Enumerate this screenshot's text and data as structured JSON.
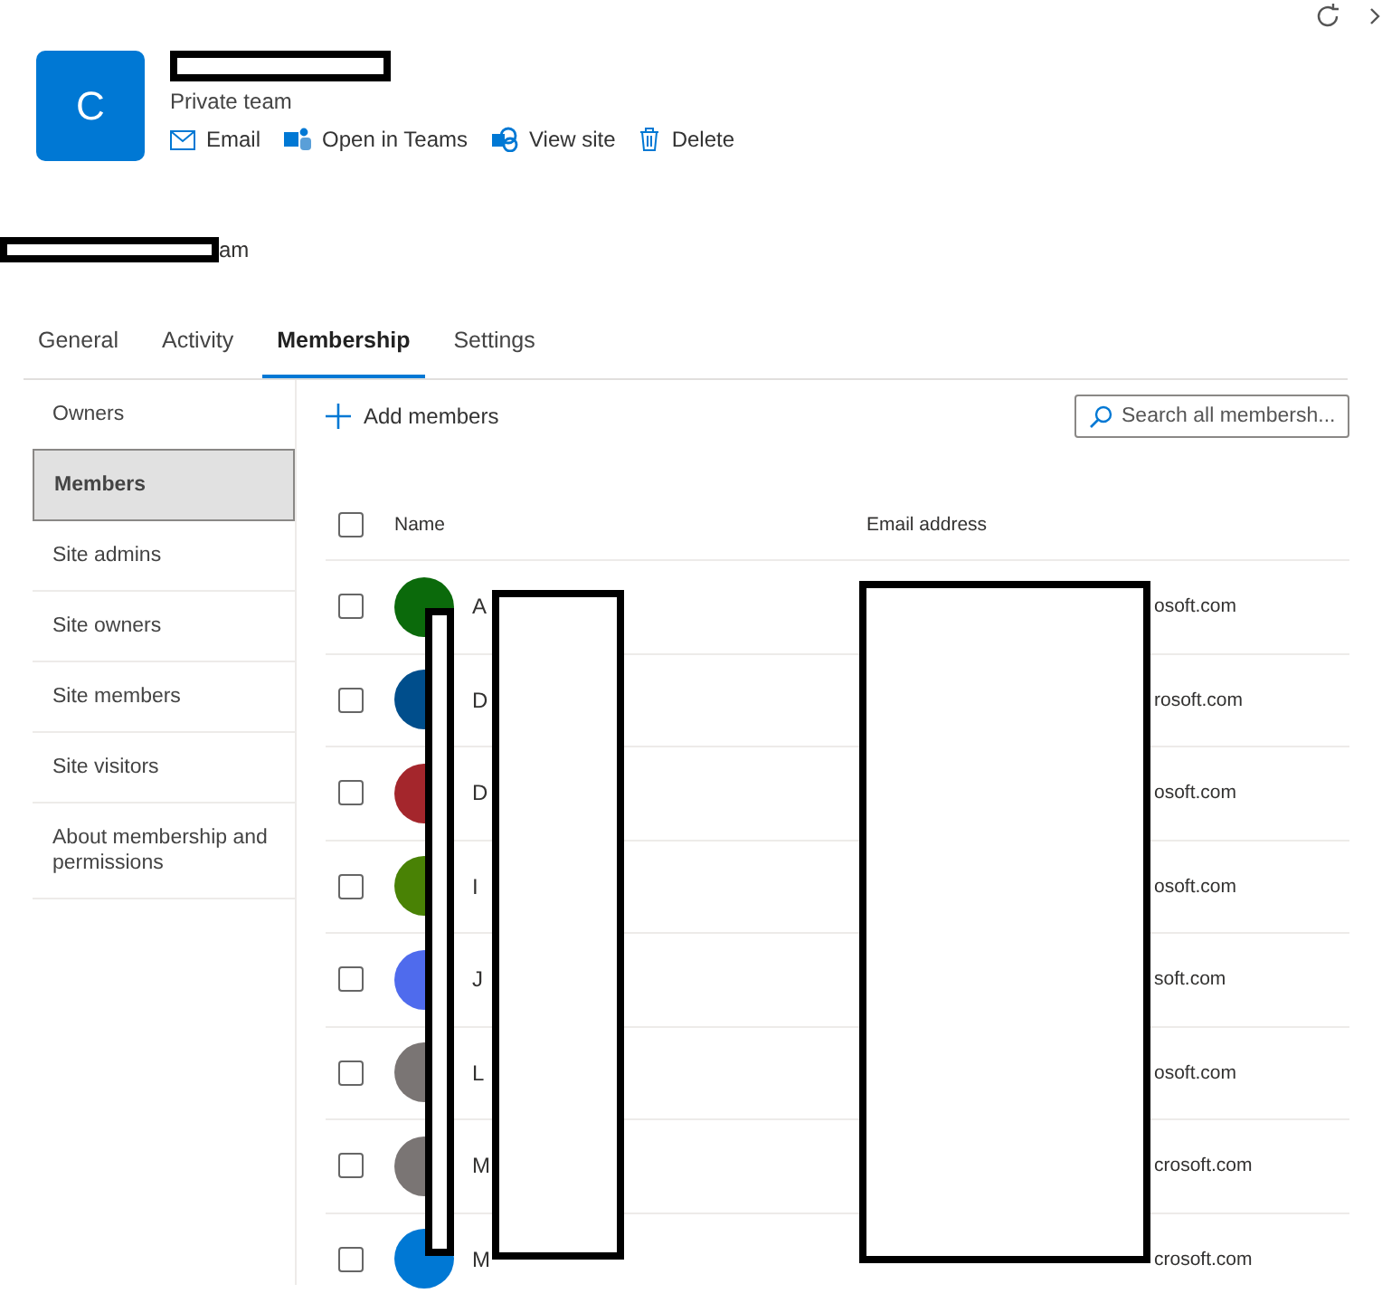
{
  "team": {
    "initial": "C",
    "privacy": "Private team"
  },
  "actions": [
    {
      "kind": "email",
      "label": "Email"
    },
    {
      "kind": "teams",
      "label": "Open in Teams"
    },
    {
      "kind": "site",
      "label": "View site"
    },
    {
      "kind": "delete",
      "label": "Delete"
    }
  ],
  "subtitle_fragment": "am",
  "tabs": [
    {
      "label": "General",
      "selected": false
    },
    {
      "label": "Activity",
      "selected": false
    },
    {
      "label": "Membership",
      "selected": true
    },
    {
      "label": "Settings",
      "selected": false
    }
  ],
  "sidebar": {
    "items": [
      {
        "label": "Owners",
        "selected": false
      },
      {
        "label": "Members",
        "selected": true
      },
      {
        "label": "Site admins",
        "selected": false
      },
      {
        "label": "Site owners",
        "selected": false
      },
      {
        "label": "Site members",
        "selected": false
      },
      {
        "label": "Site visitors",
        "selected": false
      },
      {
        "label": "About membership and permissions",
        "selected": false
      }
    ]
  },
  "add_button": "Add members",
  "search": {
    "placeholder": "Search all membersh..."
  },
  "table": {
    "select_all_checked": false,
    "columns": [
      "Name",
      "Email address"
    ],
    "rows": [
      {
        "color": "#0b6a0b",
        "name": "A",
        "email": "osoft.com",
        "checked": false
      },
      {
        "color": "#004e8c",
        "name": "D",
        "email": "rosoft.com",
        "checked": false
      },
      {
        "color": "#a4262c",
        "name": "D",
        "email": "osoft.com",
        "checked": false
      },
      {
        "color": "#498205",
        "name": "I",
        "email": "osoft.com",
        "checked": false
      },
      {
        "color": "#4f6bed",
        "name": "J",
        "email": "soft.com",
        "checked": false
      },
      {
        "color": "#7a7574",
        "name": "L",
        "email": "osoft.com",
        "checked": false
      },
      {
        "color": "#7a7574",
        "name": "M",
        "email": "crosoft.com",
        "checked": false
      },
      {
        "color": "#0078d4",
        "name": "M",
        "email": "crosoft.com",
        "checked": false
      }
    ]
  }
}
